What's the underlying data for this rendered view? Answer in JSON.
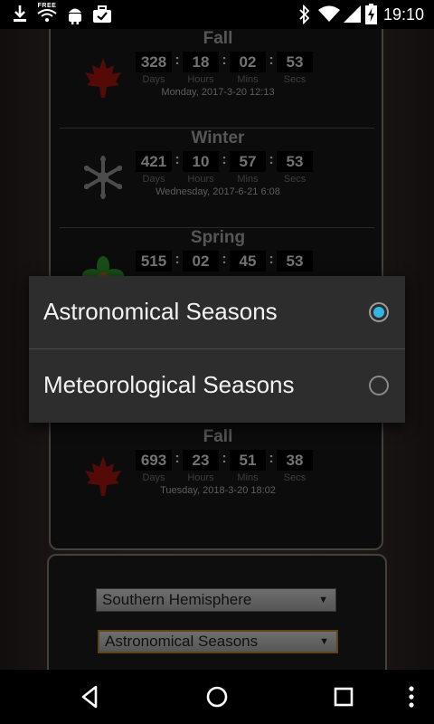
{
  "status_bar": {
    "time": "19:10",
    "left_icons": [
      "download-icon",
      "wifi-free-icon",
      "android-icon",
      "briefcase-check-icon"
    ],
    "right_icons": [
      "bluetooth-icon",
      "wifi-icon",
      "cell-signal-icon",
      "battery-charging-icon"
    ],
    "wifi_badge_text": "FREE"
  },
  "units": {
    "days": "Days",
    "hours": "Hours",
    "mins": "Mins",
    "secs": "Secs"
  },
  "seasons": [
    {
      "name": "Fall",
      "days": "328",
      "hours": "18",
      "mins": "02",
      "secs": "53",
      "date": "Monday, 2017-3-20  12:13",
      "icon": "maple-leaf-icon"
    },
    {
      "name": "Winter",
      "days": "421",
      "hours": "10",
      "mins": "57",
      "secs": "53",
      "date": "Wednesday, 2017-6-21  6:08",
      "icon": "snowflake-icon"
    },
    {
      "name": "Spring",
      "days": "515",
      "hours": "02",
      "mins": "45",
      "secs": "53",
      "date": "",
      "icon": "flower-icon"
    },
    {
      "name": "Fall",
      "days": "693",
      "hours": "23",
      "mins": "51",
      "secs": "38",
      "date": "Tuesday, 2018-3-20  18:02",
      "icon": "maple-leaf-icon"
    }
  ],
  "settings": {
    "hemisphere_selected": "Southern Hemisphere",
    "season_type_selected": "Astronomical Seasons"
  },
  "dialog": {
    "options": [
      {
        "label": "Astronomical Seasons",
        "checked": true
      },
      {
        "label": "Meteorological Seasons",
        "checked": false
      }
    ]
  },
  "colors": {
    "accent": "#33b5e5",
    "focus_border": "#ab7c2e"
  }
}
